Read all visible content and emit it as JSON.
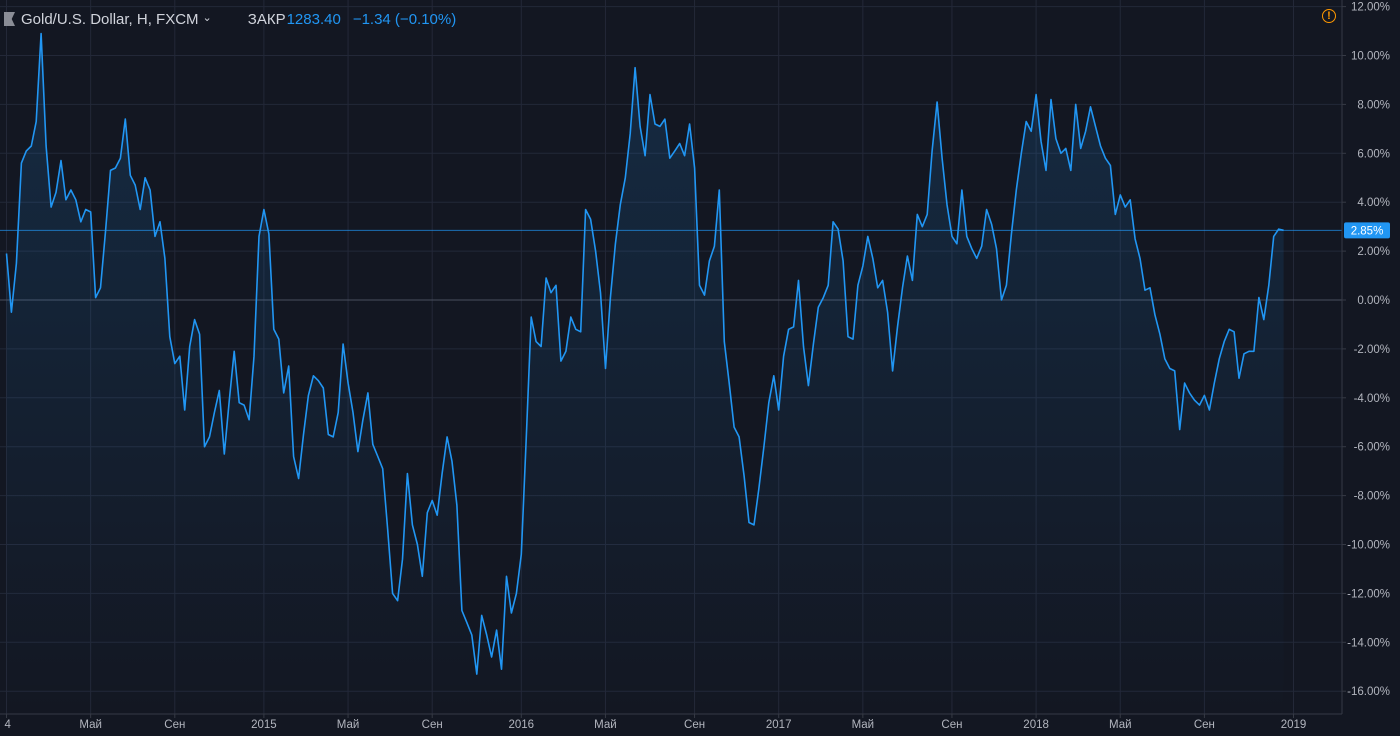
{
  "header": {
    "symbol": "Gold/U.S. Dollar, H, FXCM",
    "chevron": "⌄",
    "close_label": "ЗАКР",
    "close_value": "1283.40",
    "change": "−1.34 (−0.10%)",
    "warning_glyph": "!"
  },
  "colors": {
    "background": "#131722",
    "line": "#2196f3",
    "grid": "#232838",
    "axis_text": "#b2b5be",
    "warning": "#ff9800"
  },
  "chart_data": {
    "type": "area",
    "title": "",
    "xlabel": "",
    "ylabel": "",
    "y_unit": "%",
    "ylim": [
      -17,
      12.2
    ],
    "grid": true,
    "y_ticks": [
      "12.00%",
      "10.00%",
      "8.00%",
      "6.00%",
      "4.00%",
      "2.00%",
      "0.00%",
      "-2.00%",
      "-4.00%",
      "-6.00%",
      "-8.00%",
      "-10.00%",
      "-12.00%",
      "-14.00%",
      "-16.00%"
    ],
    "y_tick_values": [
      12,
      10,
      8,
      6,
      4,
      2,
      0,
      -2,
      -4,
      -6,
      -8,
      -10,
      -12,
      -14,
      -16
    ],
    "x_ticks": [
      "4",
      "Май",
      "Сен",
      "2015",
      "Май",
      "Сен",
      "2016",
      "Май",
      "Сен",
      "2017",
      "Май",
      "Сен",
      "2018",
      "Май",
      "Сен",
      "2019"
    ],
    "x_tick_weeks": [
      0,
      17,
      34,
      52,
      69,
      86,
      104,
      121,
      139,
      156,
      173,
      191,
      208,
      225,
      242,
      260
    ],
    "last_value": 2.85,
    "last_label": "2.85%",
    "zero_line": 0,
    "series": [
      {
        "values": [
          1.9,
          -0.5,
          1.5,
          5.6,
          6.1,
          6.3,
          7.3,
          10.9,
          6.3,
          3.8,
          4.4,
          5.7,
          4.1,
          4.5,
          4.1,
          3.2,
          3.7,
          3.6,
          0.1,
          0.5,
          2.8,
          5.3,
          5.4,
          5.8,
          7.4,
          5.1,
          4.7,
          3.7,
          5.0,
          4.5,
          2.6,
          3.2,
          1.7,
          -1.5,
          -2.6,
          -2.3,
          -4.5,
          -1.9,
          -0.8,
          -1.4,
          -6.0,
          -5.6,
          -4.6,
          -3.7,
          -6.3,
          -4.1,
          -2.1,
          -4.2,
          -4.3,
          -4.9,
          -2.3,
          2.6,
          3.7,
          2.7,
          -1.2,
          -1.6,
          -3.8,
          -2.7,
          -6.4,
          -7.3,
          -5.5,
          -3.9,
          -3.1,
          -3.3,
          -3.6,
          -5.5,
          -5.6,
          -4.6,
          -1.8,
          -3.4,
          -4.6,
          -6.2,
          -4.9,
          -3.8,
          -5.9,
          -6.4,
          -6.9,
          -9.4,
          -12.0,
          -12.3,
          -10.6,
          -7.1,
          -9.2,
          -10.0,
          -11.3,
          -8.7,
          -8.2,
          -8.8,
          -7.1,
          -5.6,
          -6.6,
          -8.4,
          -12.7,
          -13.2,
          -13.7,
          -15.3,
          -12.9,
          -13.7,
          -14.6,
          -13.5,
          -15.1,
          -11.3,
          -12.8,
          -12.0,
          -10.4,
          -5.6,
          -0.7,
          -1.7,
          -1.9,
          0.9,
          0.3,
          0.6,
          -2.5,
          -2.1,
          -0.7,
          -1.2,
          -1.3,
          3.7,
          3.3,
          2.0,
          0.3,
          -2.8,
          0.1,
          2.3,
          3.9,
          5.0,
          6.8,
          9.5,
          7.1,
          5.9,
          8.4,
          7.2,
          7.1,
          7.4,
          5.8,
          6.1,
          6.4,
          5.9,
          7.2,
          5.4,
          0.6,
          0.2,
          1.6,
          2.2,
          4.5,
          -1.7,
          -3.4,
          -5.2,
          -5.6,
          -7.2,
          -9.1,
          -9.2,
          -7.7,
          -6.0,
          -4.2,
          -3.1,
          -4.5,
          -2.3,
          -1.2,
          -1.1,
          0.8,
          -1.9,
          -3.5,
          -1.8,
          -0.3,
          0.1,
          0.6,
          3.2,
          2.9,
          1.6,
          -1.5,
          -1.6,
          0.6,
          1.4,
          2.6,
          1.7,
          0.5,
          0.8,
          -0.5,
          -2.9,
          -1.1,
          0.5,
          1.8,
          0.8,
          3.5,
          3.0,
          3.5,
          6.1,
          8.1,
          5.8,
          3.9,
          2.6,
          2.3,
          4.5,
          2.6,
          2.1,
          1.7,
          2.2,
          3.7,
          3.1,
          2.1,
          0.0,
          0.6,
          2.7,
          4.5,
          6.0,
          7.3,
          6.9,
          8.4,
          6.5,
          5.3,
          8.2,
          6.6,
          6.0,
          6.2,
          5.3,
          8.0,
          6.2,
          6.9,
          7.9,
          7.1,
          6.3,
          5.8,
          5.5,
          3.5,
          4.3,
          3.8,
          4.1,
          2.5,
          1.7,
          0.4,
          0.5,
          -0.6,
          -1.4,
          -2.4,
          -2.8,
          -2.9,
          -5.3,
          -3.4,
          -3.8,
          -4.1,
          -4.3,
          -3.9,
          -4.5,
          -3.4,
          -2.4,
          -1.7,
          -1.2,
          -1.3,
          -3.2,
          -2.2,
          -2.1,
          -2.1,
          0.1,
          -0.8,
          0.6,
          2.6,
          2.9,
          2.85
        ]
      }
    ]
  }
}
